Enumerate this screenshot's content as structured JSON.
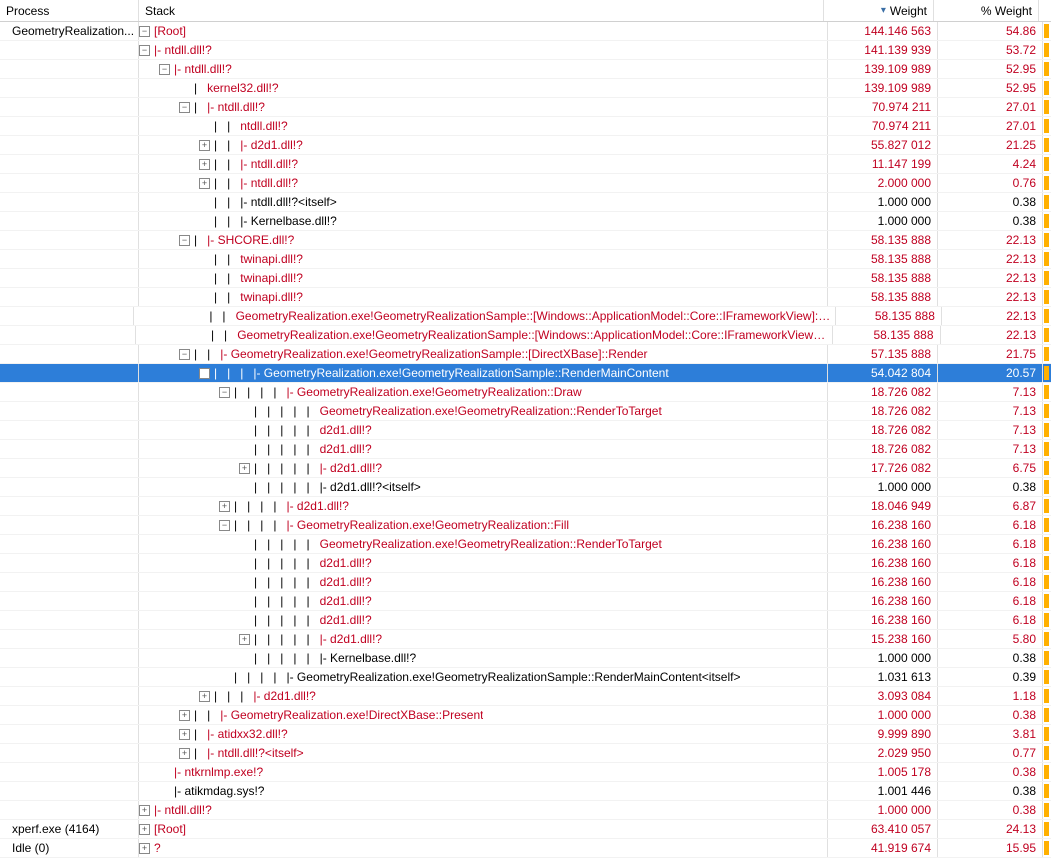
{
  "columns": {
    "process": "Process",
    "stack": "Stack",
    "weight": "Weight",
    "pct": "% Weight"
  },
  "expander": {
    "plus": "+",
    "minus": "−"
  },
  "rows": [
    {
      "process": "GeometryRealization...",
      "indent": 0,
      "exp": "minus",
      "prefix": "",
      "label": "[Root]",
      "weight": "144.146 563",
      "pct": "54.86",
      "color": "red",
      "bar": true
    },
    {
      "process": "",
      "indent": 0,
      "exp": "minus",
      "prefix": "",
      "label": "|- ntdll.dll!?",
      "weight": "141.139 939",
      "pct": "53.72",
      "color": "red",
      "bar": true
    },
    {
      "process": "",
      "indent": 1,
      "exp": "minus",
      "prefix": "",
      "label": "|- ntdll.dll!?",
      "weight": "139.109 989",
      "pct": "52.95",
      "color": "red",
      "bar": true
    },
    {
      "process": "",
      "indent": 2,
      "exp": "blank",
      "prefix": "|   ",
      "label": "kernel32.dll!?",
      "weight": "139.109 989",
      "pct": "52.95",
      "color": "red",
      "bar": true
    },
    {
      "process": "",
      "indent": 2,
      "exp": "minus",
      "prefix": "|   ",
      "label": "|- ntdll.dll!?",
      "weight": "70.974 211",
      "pct": "27.01",
      "color": "red",
      "bar": true
    },
    {
      "process": "",
      "indent": 3,
      "exp": "blank",
      "prefix": "|   |   ",
      "label": "ntdll.dll!?",
      "weight": "70.974 211",
      "pct": "27.01",
      "color": "red",
      "bar": true
    },
    {
      "process": "",
      "indent": 3,
      "exp": "plus",
      "prefix": "|   |   ",
      "label": "|- d2d1.dll!?",
      "weight": "55.827 012",
      "pct": "21.25",
      "color": "red",
      "bar": true
    },
    {
      "process": "",
      "indent": 3,
      "exp": "plus",
      "prefix": "|   |   ",
      "label": "|- ntdll.dll!?",
      "weight": "11.147 199",
      "pct": "4.24",
      "color": "red",
      "bar": true
    },
    {
      "process": "",
      "indent": 3,
      "exp": "plus",
      "prefix": "|   |   ",
      "label": "|- ntdll.dll!?",
      "weight": "2.000 000",
      "pct": "0.76",
      "color": "red",
      "bar": true
    },
    {
      "process": "",
      "indent": 3,
      "exp": "blank",
      "prefix": "|   |   ",
      "label": "|- ntdll.dll!?<itself>",
      "weight": "1.000 000",
      "pct": "0.38",
      "color": "black",
      "bar": true
    },
    {
      "process": "",
      "indent": 3,
      "exp": "blank",
      "prefix": "|   |   ",
      "label": "|- Kernelbase.dll!?",
      "weight": "1.000 000",
      "pct": "0.38",
      "color": "black",
      "bar": true
    },
    {
      "process": "",
      "indent": 2,
      "exp": "minus",
      "prefix": "|   ",
      "label": "|- SHCORE.dll!?",
      "weight": "58.135 888",
      "pct": "22.13",
      "color": "red",
      "bar": true
    },
    {
      "process": "",
      "indent": 3,
      "exp": "blank",
      "prefix": "|   |   ",
      "label": "twinapi.dll!?",
      "weight": "58.135 888",
      "pct": "22.13",
      "color": "red",
      "bar": true
    },
    {
      "process": "",
      "indent": 3,
      "exp": "blank",
      "prefix": "|   |   ",
      "label": "twinapi.dll!?",
      "weight": "58.135 888",
      "pct": "22.13",
      "color": "red",
      "bar": true
    },
    {
      "process": "",
      "indent": 3,
      "exp": "blank",
      "prefix": "|   |   ",
      "label": "twinapi.dll!?",
      "weight": "58.135 888",
      "pct": "22.13",
      "color": "red",
      "bar": true
    },
    {
      "process": "",
      "indent": 3,
      "exp": "blank",
      "prefix": "|   |   ",
      "label": "GeometryRealization.exe!GeometryRealizationSample::[Windows::ApplicationModel::Core::IFrameworkView]::__abi_",
      "weight": "58.135 888",
      "pct": "22.13",
      "color": "red",
      "bar": true
    },
    {
      "process": "",
      "indent": 3,
      "exp": "blank",
      "prefix": "|   |   ",
      "label": "GeometryRealization.exe!GeometryRealizationSample::[Windows::ApplicationModel::Core::IFrameworkView]::Run",
      "weight": "58.135 888",
      "pct": "22.13",
      "color": "red",
      "bar": true
    },
    {
      "process": "",
      "indent": 2,
      "exp": "minus",
      "prefix": "|   |   ",
      "label": "|- GeometryRealization.exe!GeometryRealizationSample::[DirectXBase]::Render",
      "weight": "57.135 888",
      "pct": "21.75",
      "color": "red",
      "bar": true
    },
    {
      "process": "",
      "indent": 3,
      "exp": "minus",
      "prefix": "|   |   |   ",
      "label": "|- GeometryRealization.exe!GeometryRealizationSample::RenderMainContent",
      "weight": "54.042 804",
      "pct": "20.57",
      "color": "red",
      "bar": true,
      "selected": true
    },
    {
      "process": "",
      "indent": 4,
      "exp": "minus",
      "prefix": "|   |   |   |   ",
      "label": "|- GeometryRealization.exe!GeometryRealization::Draw",
      "weight": "18.726 082",
      "pct": "7.13",
      "color": "red",
      "bar": true
    },
    {
      "process": "",
      "indent": 5,
      "exp": "blank",
      "prefix": "|   |   |   |   |   ",
      "label": "GeometryRealization.exe!GeometryRealization::RenderToTarget",
      "weight": "18.726 082",
      "pct": "7.13",
      "color": "red",
      "bar": true
    },
    {
      "process": "",
      "indent": 5,
      "exp": "blank",
      "prefix": "|   |   |   |   |   ",
      "label": "d2d1.dll!?",
      "weight": "18.726 082",
      "pct": "7.13",
      "color": "red",
      "bar": true
    },
    {
      "process": "",
      "indent": 5,
      "exp": "blank",
      "prefix": "|   |   |   |   |   ",
      "label": "d2d1.dll!?",
      "weight": "18.726 082",
      "pct": "7.13",
      "color": "red",
      "bar": true
    },
    {
      "process": "",
      "indent": 5,
      "exp": "plus",
      "prefix": "|   |   |   |   |   ",
      "label": "|- d2d1.dll!?",
      "weight": "17.726 082",
      "pct": "6.75",
      "color": "red",
      "bar": true
    },
    {
      "process": "",
      "indent": 5,
      "exp": "blank",
      "prefix": "|   |   |   |   |   ",
      "label": "|- d2d1.dll!?<itself>",
      "weight": "1.000 000",
      "pct": "0.38",
      "color": "black",
      "bar": true
    },
    {
      "process": "",
      "indent": 4,
      "exp": "plus",
      "prefix": "|   |   |   |   ",
      "label": "|- d2d1.dll!?",
      "weight": "18.046 949",
      "pct": "6.87",
      "color": "red",
      "bar": true
    },
    {
      "process": "",
      "indent": 4,
      "exp": "minus",
      "prefix": "|   |   |   |   ",
      "label": "|- GeometryRealization.exe!GeometryRealization::Fill",
      "weight": "16.238 160",
      "pct": "6.18",
      "color": "red",
      "bar": true
    },
    {
      "process": "",
      "indent": 5,
      "exp": "blank",
      "prefix": "|   |   |   |   |   ",
      "label": "GeometryRealization.exe!GeometryRealization::RenderToTarget",
      "weight": "16.238 160",
      "pct": "6.18",
      "color": "red",
      "bar": true
    },
    {
      "process": "",
      "indent": 5,
      "exp": "blank",
      "prefix": "|   |   |   |   |   ",
      "label": "d2d1.dll!?",
      "weight": "16.238 160",
      "pct": "6.18",
      "color": "red",
      "bar": true
    },
    {
      "process": "",
      "indent": 5,
      "exp": "blank",
      "prefix": "|   |   |   |   |   ",
      "label": "d2d1.dll!?",
      "weight": "16.238 160",
      "pct": "6.18",
      "color": "red",
      "bar": true
    },
    {
      "process": "",
      "indent": 5,
      "exp": "blank",
      "prefix": "|   |   |   |   |   ",
      "label": "d2d1.dll!?",
      "weight": "16.238 160",
      "pct": "6.18",
      "color": "red",
      "bar": true
    },
    {
      "process": "",
      "indent": 5,
      "exp": "blank",
      "prefix": "|   |   |   |   |   ",
      "label": "d2d1.dll!?",
      "weight": "16.238 160",
      "pct": "6.18",
      "color": "red",
      "bar": true
    },
    {
      "process": "",
      "indent": 5,
      "exp": "plus",
      "prefix": "|   |   |   |   |   ",
      "label": "|- d2d1.dll!?",
      "weight": "15.238 160",
      "pct": "5.80",
      "color": "red",
      "bar": true
    },
    {
      "process": "",
      "indent": 5,
      "exp": "blank",
      "prefix": "|   |   |   |   |   ",
      "label": "|- Kernelbase.dll!?",
      "weight": "1.000 000",
      "pct": "0.38",
      "color": "black",
      "bar": true
    },
    {
      "process": "",
      "indent": 4,
      "exp": "blank",
      "prefix": "|   |   |   |   ",
      "label": "|- GeometryRealization.exe!GeometryRealizationSample::RenderMainContent<itself>",
      "weight": "1.031 613",
      "pct": "0.39",
      "color": "black",
      "bar": true
    },
    {
      "process": "",
      "indent": 3,
      "exp": "plus",
      "prefix": "|   |   |   ",
      "label": "|- d2d1.dll!?",
      "weight": "3.093 084",
      "pct": "1.18",
      "color": "red",
      "bar": true
    },
    {
      "process": "",
      "indent": 2,
      "exp": "plus",
      "prefix": "|   |   ",
      "label": "|- GeometryRealization.exe!DirectXBase::Present",
      "weight": "1.000 000",
      "pct": "0.38",
      "color": "red",
      "bar": true
    },
    {
      "process": "",
      "indent": 2,
      "exp": "plus",
      "prefix": "|   ",
      "label": "|- atidxx32.dll!?",
      "weight": "9.999 890",
      "pct": "3.81",
      "color": "red",
      "bar": true
    },
    {
      "process": "",
      "indent": 2,
      "exp": "plus",
      "prefix": "|   ",
      "label": "|- ntdll.dll!?<itself>",
      "weight": "2.029 950",
      "pct": "0.77",
      "color": "red",
      "bar": true
    },
    {
      "process": "",
      "indent": 1,
      "exp": "blank",
      "prefix": "",
      "label": "|- ntkrnlmp.exe!?",
      "weight": "1.005 178",
      "pct": "0.38",
      "color": "red",
      "bar": true
    },
    {
      "process": "",
      "indent": 1,
      "exp": "blank",
      "prefix": "",
      "label": "|- atikmdag.sys!?",
      "weight": "1.001 446",
      "pct": "0.38",
      "color": "black",
      "bar": true
    },
    {
      "process": "",
      "indent": 0,
      "exp": "plus",
      "prefix": "",
      "label": "|- ntdll.dll!?",
      "weight": "1.000 000",
      "pct": "0.38",
      "color": "red",
      "bar": true
    },
    {
      "process": "xperf.exe (4164)",
      "indent": 0,
      "exp": "plus",
      "prefix": "",
      "label": "[Root]",
      "weight": "63.410 057",
      "pct": "24.13",
      "color": "red",
      "bar": true
    },
    {
      "process": "Idle (0)",
      "indent": 0,
      "exp": "plus",
      "prefix": "",
      "label": "?",
      "weight": "41.919 674",
      "pct": "15.95",
      "color": "red",
      "bar": true
    }
  ]
}
